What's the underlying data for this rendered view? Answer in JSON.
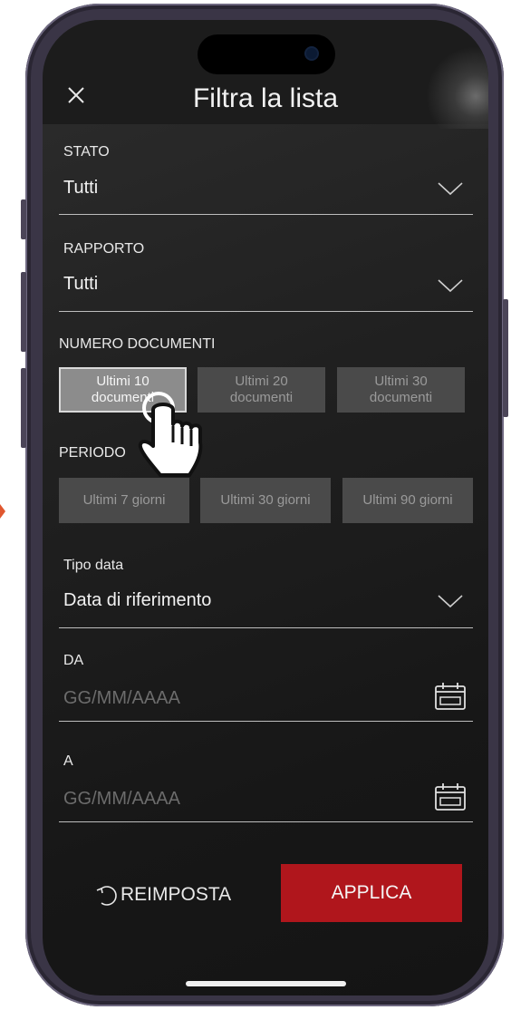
{
  "header": {
    "title": "Filtra la lista"
  },
  "stato": {
    "label": "STATO",
    "value": "Tutti"
  },
  "rapporto": {
    "label": "RAPPORTO",
    "value": "Tutti"
  },
  "numero_documenti": {
    "label": "NUMERO DOCUMENTI",
    "options": [
      {
        "line1": "Ultimi 10",
        "line2": "documenti",
        "selected": true
      },
      {
        "line1": "Ultimi 20",
        "line2": "documenti",
        "selected": false
      },
      {
        "line1": "Ultimi 30",
        "line2": "documenti",
        "selected": false
      }
    ]
  },
  "periodo": {
    "label": "PERIODO",
    "options": [
      "Ultimi 7 giorni",
      "Ultimi 30 giorni",
      "Ultimi 90 giorni"
    ]
  },
  "tipo_data": {
    "label": "Tipo data",
    "value": "Data di riferimento"
  },
  "da": {
    "label": "DA",
    "placeholder": "GG/MM/AAAA"
  },
  "a": {
    "label": "A",
    "placeholder": "GG/MM/AAAA"
  },
  "actions": {
    "reset_label": "REIMPOSTA",
    "apply_label": "APPLICA"
  },
  "colors": {
    "accent": "#b0161c",
    "background": "#1c1c1c",
    "selected_chip": "#8c8c8c"
  },
  "icons": {
    "close": "close-icon",
    "dropdown": "chevron-down-icon",
    "calendar": "calendar-icon",
    "reset": "reset-icon",
    "pointer": "hand-pointer-icon"
  }
}
